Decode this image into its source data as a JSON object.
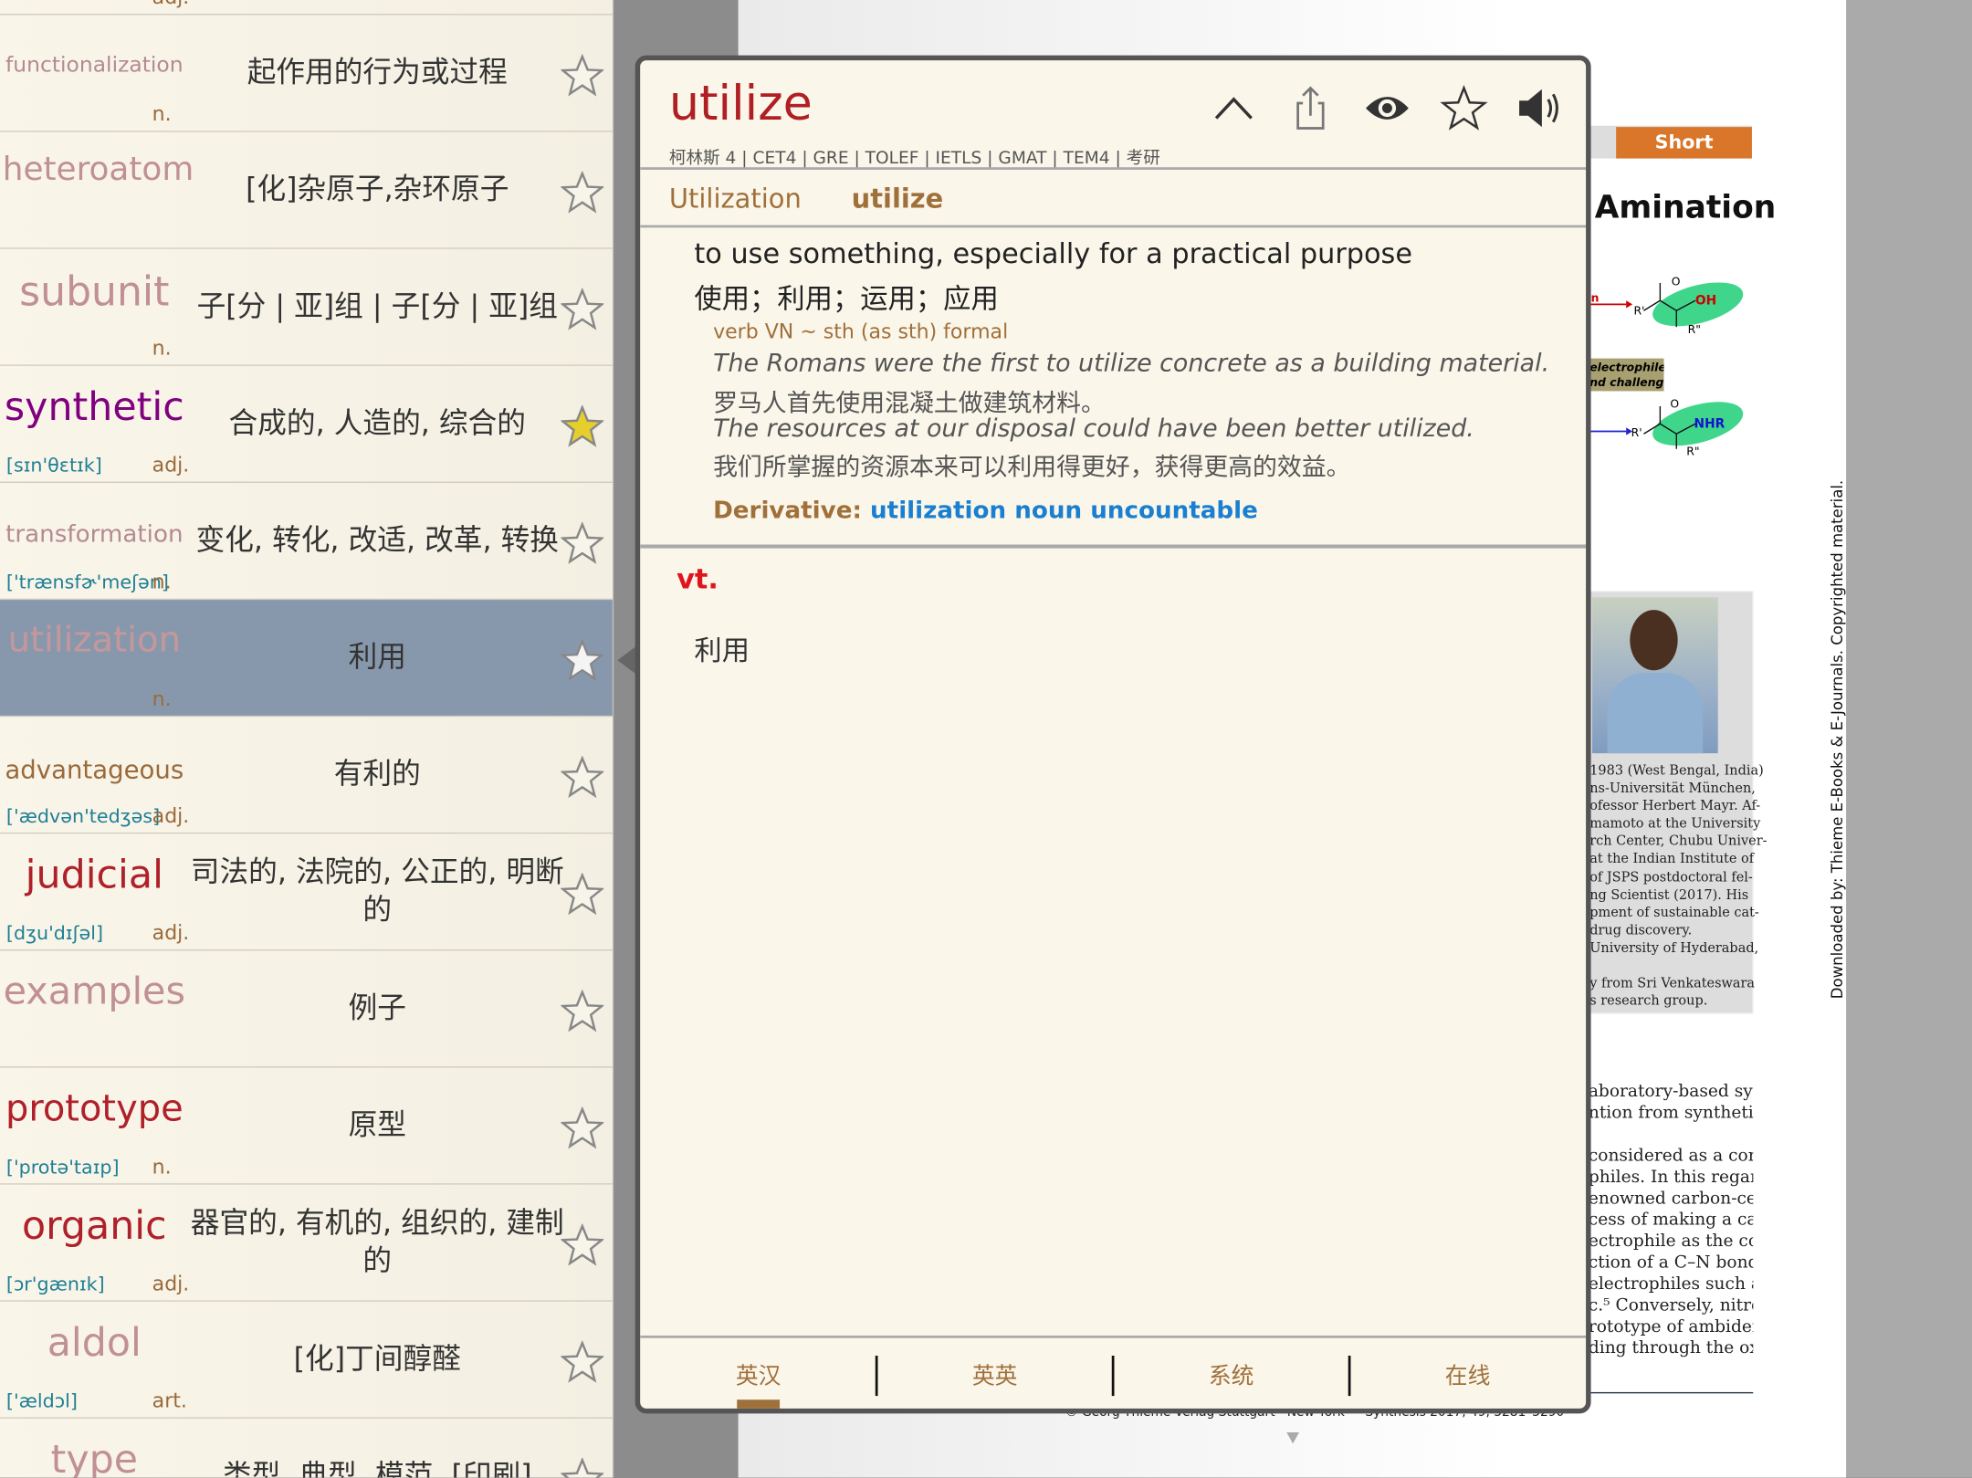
{
  "word_list": [
    {
      "word": "functionalization",
      "pos": "n.",
      "pron": "",
      "meaning": "起作用的行为或过程",
      "color": "#b48a92",
      "size": 17,
      "starred": false
    },
    {
      "word": "heteroatom",
      "pos": "",
      "pron": "",
      "meaning": "[化]杂原子,杂环原子",
      "color": "#c09096",
      "size": 26,
      "starred": false
    },
    {
      "word": "subunit",
      "pos": "n.",
      "pron": "",
      "meaning": "子[分 | 亚]组 | 子[分 | 亚]组",
      "color": "#c09096",
      "size": 32,
      "starred": false
    },
    {
      "word": "synthetic",
      "pos": "adj.",
      "pron": "[sɪn'θɛtɪk]",
      "meaning": "合成的, 人造的, 综合的",
      "color": "#800080",
      "size": 31,
      "starred": true
    },
    {
      "word": "transformation",
      "pos": "n.",
      "pron": "['trænsfɚ'meʃən]",
      "meaning": "变化, 转化, 改适, 改革, 转换",
      "color": "#b48a92",
      "size": 19,
      "starred": false
    },
    {
      "word": "utilization",
      "pos": "n.",
      "pron": "",
      "meaning": "利用",
      "color": "#c5979b",
      "size": 28,
      "starred": false,
      "selected": true
    },
    {
      "word": "advantageous",
      "pos": "adj.",
      "pron": "['ædvən'tedʒəs]",
      "meaning": "有利的",
      "color": "#9a6a3a",
      "size": 20,
      "starred": false
    },
    {
      "word": "judicial",
      "pos": "adj.",
      "pron": "[dʒu'dɪʃəl]",
      "meaning": "司法的, 法院的, 公正的, 明断的",
      "color": "#b0202a",
      "size": 31,
      "starred": false
    },
    {
      "word": "examples",
      "pos": "",
      "pron": "",
      "meaning": "例子",
      "color": "#c09096",
      "size": 30,
      "starred": false
    },
    {
      "word": "prototype",
      "pos": "n.",
      "pron": "['protə'taɪp]",
      "meaning": "原型",
      "color": "#b0202a",
      "size": 29,
      "starred": false
    },
    {
      "word": "organic",
      "pos": "adj.",
      "pron": "[ɔr'gænɪk]",
      "meaning": "器官的, 有机的, 组织的, 建制的",
      "color": "#b0202a",
      "size": 31,
      "starred": false
    },
    {
      "word": "aldol",
      "pos": "art.",
      "pron": "['ældɔl]",
      "meaning": "[化]丁间醇醛",
      "color": "#c09096",
      "size": 31,
      "starred": false
    },
    {
      "word": "type",
      "pos": "",
      "pron": "",
      "meaning": "类型, 典型, 模范, [印刷]",
      "color": "#c09096",
      "size": 31,
      "starred": false
    }
  ],
  "top_partial_pos": "adj.",
  "popup": {
    "headword": "utilize",
    "tags": "柯林斯 4 | CET4 | GRE | TOLEF | IETLS | GMAT | TEM4 | 考研",
    "forms": [
      "Utilization",
      "utilize"
    ],
    "definition_en": "to use something, especially for a practical purpose",
    "definition_zh": "使用；利用；运用；应用",
    "grammar": "verb VN ~ sth (as sth) formal",
    "examples": [
      {
        "en": "The Romans were the first to utilize concrete as a building material.",
        "zh": "罗马人首先使用混凝土做建筑材料。"
      },
      {
        "en": "The resources at our disposal could have been better utilized.",
        "zh": "我们所掌握的资源本来可以利用得更好，获得更高的效益。"
      }
    ],
    "derivative_label": "Derivative:",
    "derivative_value": "utilization noun uncountable",
    "pos": "vt.",
    "meaning": "利用",
    "tabs": [
      "英汉",
      "英英",
      "系统",
      "在线"
    ],
    "active_tab": 0,
    "icons": [
      "chevron-up-icon",
      "share-icon",
      "eye-icon",
      "star-icon",
      "speaker-icon"
    ]
  },
  "document": {
    "badge": "Short Review",
    "title": "Amination",
    "scheme_box": [
      "electrophile",
      "nd challenges"
    ],
    "scheme_labels": {
      "oh": "OH",
      "nhr": "NHR",
      "r1": "R'",
      "r2": "R\"",
      "o": "O",
      "n": "n"
    },
    "caption": [
      "1983 (West Bengal, India)",
      "ns-Universität München,",
      "ofessor Herbert Mayr. Af-",
      "mamoto at the University",
      "rch Center, Chubu Univer-",
      "at the Indian Institute of",
      "of JSPS postdoctoral fel-",
      "ng Scientist (2017). His",
      "pment of sustainable cat-",
      "drug discovery.",
      "University of Hyderabad,",
      "",
      "y from Sri Venkateswara",
      "s research group."
    ],
    "body": [
      "aboratory-based syn-",
      "ntion from synthetic",
      "",
      "considered as a com-",
      "philes. In this regards,",
      "enowned carbon-cen-",
      "cess of making a car-",
      "ectrophile as the cou-",
      "ction of a C–N bond",
      "electrophiles such as",
      "c.⁵ Conversely, nitroso",
      "rototype of ambident",
      "ding through the oxy-"
    ],
    "footer": "© Georg Thieme Verlag Stuttgart · New York — Synthesis 2017, 49, 3281–3290",
    "side_note": "Downloaded by: Thieme E-Books & E-Journals. Copyrighted material."
  },
  "colors": {
    "headword": "#b01f24",
    "brown": "#a0703a",
    "selected_row": "#8898ac",
    "badge": "#d9762a",
    "link": "#1a7fd0",
    "pos_red": "#e0141c"
  }
}
